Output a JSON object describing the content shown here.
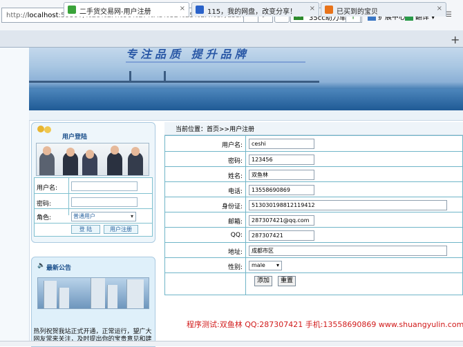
{
  "browser": {
    "url_prefix": "http://",
    "url_host": "localhost",
    "url_rest": ":59597/%E6%BA%90%E7%A8%8B%E5%BA%8F/userreg.aspx",
    "search_engine": "35cc助力车",
    "toolbar_ext": "扩展中心",
    "toolbar_translate": "翻译",
    "tabs": [
      {
        "label": "二手货交易网-用户注册",
        "icon_color": "#3aa33a"
      },
      {
        "label": "115，我的网盘，改变分享！",
        "icon_color": "#2a62c9"
      },
      {
        "label": "已买到的宝贝",
        "icon_color": "#e8731a"
      }
    ],
    "tab_close": "×",
    "new_tab": "+"
  },
  "banner": {
    "slogan": "专注品质 提升品牌"
  },
  "login": {
    "title": "用户登陆",
    "username_label": "用户名:",
    "password_label": "密码:",
    "role_label": "角色:",
    "role_value": "普通用户",
    "login_button": "登 陆",
    "register_button": "用户注册"
  },
  "notice": {
    "title": "最新公告",
    "text": "热列祝贺我站正式开通，正常运行，望广大网友常来关注，及时提出你的宝贵意见和建"
  },
  "form": {
    "breadcrumb": "当前位置：首页>>用户注册",
    "fields": [
      {
        "label": "用户名:",
        "value": "ceshi"
      },
      {
        "label": "密码:",
        "value": "123456"
      },
      {
        "label": "姓名:",
        "value": "双鱼林"
      },
      {
        "label": "电话:",
        "value": "13558690869"
      },
      {
        "label": "身份证:",
        "value": "513030198812119412"
      },
      {
        "label": "邮箱:",
        "value": "287307421@qq.com"
      },
      {
        "label": "QQ:",
        "value": "287307421"
      },
      {
        "label": "地址:",
        "value": "成都市区"
      },
      {
        "label": "性别:",
        "value": "male"
      }
    ],
    "add_button": "添加",
    "reset_button": "重置"
  },
  "credit": "程序测试:双鱼林 QQ:287307421 手机:13558690869 www.shuangyulin.com",
  "colors": {
    "accent": "#2b64a0",
    "border": "#6fb5c8",
    "credit": "#d11a1a"
  }
}
